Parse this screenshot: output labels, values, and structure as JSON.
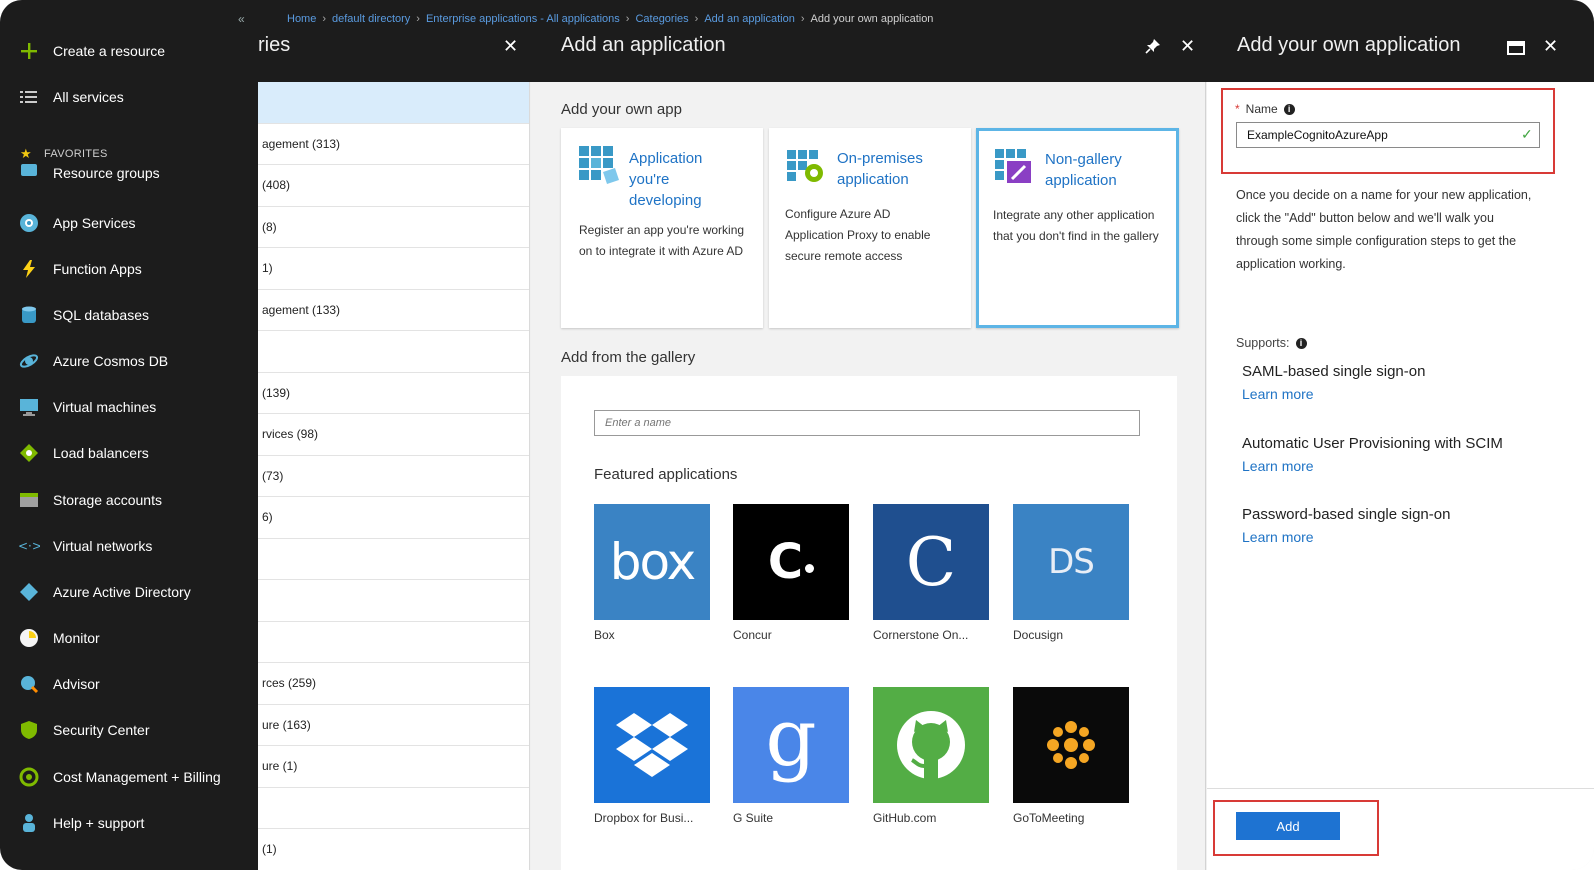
{
  "sidebar": {
    "collapse_icon": "«",
    "items": [
      {
        "label": "Create a resource",
        "icon": "plus-icon",
        "color": "#7fba00"
      },
      {
        "label": "All services",
        "icon": "list-icon",
        "color": "#cccccc"
      }
    ],
    "favorites_label": "FAVORITES",
    "favorites": [
      {
        "label": "Resource groups",
        "icon": "resource-groups-icon"
      },
      {
        "label": "App Services",
        "icon": "app-services-icon"
      },
      {
        "label": "Function Apps",
        "icon": "function-apps-icon"
      },
      {
        "label": "SQL databases",
        "icon": "sql-databases-icon"
      },
      {
        "label": "Azure Cosmos DB",
        "icon": "cosmos-db-icon"
      },
      {
        "label": "Virtual machines",
        "icon": "virtual-machines-icon"
      },
      {
        "label": "Load balancers",
        "icon": "load-balancers-icon"
      },
      {
        "label": "Storage accounts",
        "icon": "storage-accounts-icon"
      },
      {
        "label": "Virtual networks",
        "icon": "virtual-networks-icon"
      },
      {
        "label": "Azure Active Directory",
        "icon": "active-directory-icon"
      },
      {
        "label": "Monitor",
        "icon": "monitor-icon"
      },
      {
        "label": "Advisor",
        "icon": "advisor-icon"
      },
      {
        "label": "Security Center",
        "icon": "security-center-icon"
      },
      {
        "label": "Cost Management + Billing",
        "icon": "cost-management-icon"
      },
      {
        "label": "Help + support",
        "icon": "help-support-icon"
      }
    ]
  },
  "breadcrumb": [
    {
      "label": "Home"
    },
    {
      "label": "default directory"
    },
    {
      "label": "Enterprise applications - All applications"
    },
    {
      "label": "Categories"
    },
    {
      "label": "Add an application"
    },
    {
      "label": "Add your own application"
    }
  ],
  "categories_panel": {
    "title": "ries",
    "rows": [
      "",
      "agement (313)",
      "(408)",
      "(8)",
      "1)",
      "agement (133)",
      "",
      "(139)",
      "rvices (98)",
      "(73)",
      "6)",
      "",
      "",
      "",
      "rces (259)",
      "ure (163)",
      "ure (1)",
      "",
      "(1)"
    ]
  },
  "add_panel": {
    "title": "Add an application",
    "own_app_section": "Add your own app",
    "cards": [
      {
        "title": "Application you're developing",
        "desc": "Register an app you're working on to integrate it with Azure AD",
        "icon": "app-grid-icon"
      },
      {
        "title": "On-premises application",
        "desc": "Configure Azure AD Application Proxy to enable secure remote access",
        "icon": "on-premises-icon"
      },
      {
        "title": "Non-gallery application",
        "desc": "Integrate any other application that you don't find in the gallery",
        "icon": "non-gallery-icon",
        "selected": true
      }
    ],
    "gallery_section": "Add from the gallery",
    "search_placeholder": "Enter a name",
    "featured_title": "Featured applications",
    "apps": [
      {
        "label": "Box",
        "logo_text": "box",
        "bg": "#3a83c4"
      },
      {
        "label": "Concur",
        "logo_text": "C",
        "bg": "#000000"
      },
      {
        "label": "Cornerstone On...",
        "logo_text": "C",
        "bg": "#1f4f8f"
      },
      {
        "label": "Docusign",
        "logo_text": "DS",
        "bg": "#3a83c4"
      },
      {
        "label": "Dropbox for Busi...",
        "logo_text": "",
        "bg": "#1a73d8"
      },
      {
        "label": "G Suite",
        "logo_text": "g",
        "bg": "#4a86e8"
      },
      {
        "label": "GitHub.com",
        "logo_text": "",
        "bg": "#53ad45"
      },
      {
        "label": "GoToMeeting",
        "logo_text": "",
        "bg": "#0a0a0a"
      }
    ]
  },
  "own_panel": {
    "title": "Add your own application",
    "name_label": "Name",
    "required_mark": "*",
    "name_value": "ExampleCognitoAzureApp",
    "description": "Once you decide on a name for your new application, click the \"Add\" button below and we'll walk you through some simple configuration steps to get the application working.",
    "supports_label": "Supports:",
    "supports": [
      {
        "title": "SAML-based single sign-on",
        "link": "Learn more"
      },
      {
        "title": "Automatic User Provisioning with SCIM",
        "link": "Learn more"
      },
      {
        "title": "Password-based single sign-on",
        "link": "Learn more"
      }
    ],
    "add_button": "Add"
  },
  "colors": {
    "sidebar_bg": "#1c1c1c",
    "link_blue": "#1f73c5",
    "highlight_red": "#d83a36",
    "selected_card_border": "#5db5e6",
    "add_button": "#1e73d2"
  }
}
